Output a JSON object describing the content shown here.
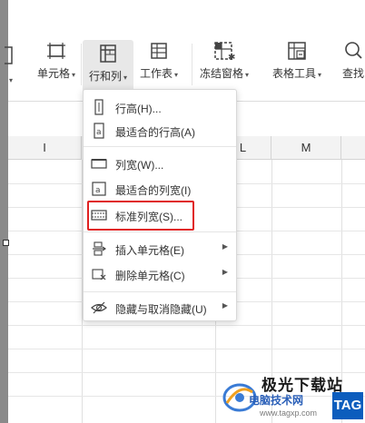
{
  "ribbon": {
    "buttons": [
      {
        "label": "单元格",
        "icon": "cell-icon",
        "dropdown": true
      },
      {
        "label": "行和列",
        "icon": "row-col-icon",
        "dropdown": true,
        "active": true
      },
      {
        "label": "工作表",
        "icon": "worksheet-icon",
        "dropdown": true
      },
      {
        "label": "冻结窗格",
        "icon": "freeze-panes-icon",
        "dropdown": true
      },
      {
        "label": "表格工具",
        "icon": "table-tools-icon",
        "dropdown": true
      },
      {
        "label": "查找",
        "icon": "search-icon",
        "dropdown": false
      }
    ]
  },
  "sheet": {
    "columns": [
      "I",
      "",
      "",
      "L",
      "M"
    ]
  },
  "menu": {
    "items": [
      {
        "label": "行高(H)...",
        "icon": "row-height-icon"
      },
      {
        "label": "最适合的行高(A)",
        "icon": "autofit-row-height-icon"
      },
      {
        "label": "列宽(W)...",
        "icon": "column-width-icon"
      },
      {
        "label": "最适合的列宽(I)",
        "icon": "autofit-column-width-icon"
      },
      {
        "label": "标准列宽(S)...",
        "icon": "standard-column-width-icon",
        "highlighted": true
      },
      {
        "label": "插入单元格(E)",
        "icon": "insert-cells-icon",
        "submenu": true
      },
      {
        "label": "删除单元格(C)",
        "icon": "delete-cells-icon",
        "submenu": true
      },
      {
        "label": "隐藏与取消隐藏(U)",
        "icon": "hide-unhide-icon",
        "submenu": true
      }
    ]
  },
  "watermark": {
    "title": "极光下载站",
    "subtitle": "电脑技术网",
    "url": "www.tagxp.com",
    "badge": "TAG"
  },
  "colors": {
    "highlight_border": "#e02020",
    "active_button_bg": "#e8e8e8",
    "watermark_blue": "#0c5dbd"
  }
}
